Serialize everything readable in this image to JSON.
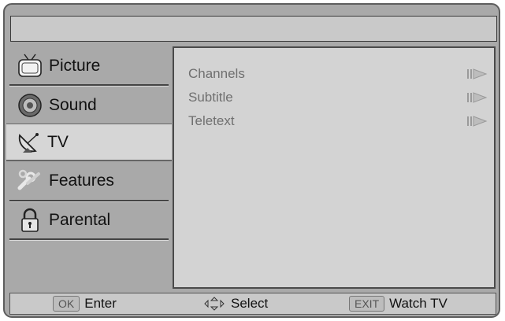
{
  "window": {
    "title": ""
  },
  "sidebar": {
    "items": [
      {
        "label": "Picture",
        "icon": "tv-icon"
      },
      {
        "label": "Sound",
        "icon": "speaker-icon"
      },
      {
        "label": "TV",
        "icon": "satellite-dish-icon"
      },
      {
        "label": "Features",
        "icon": "wrench-icon"
      },
      {
        "label": "Parental",
        "icon": "lock-icon"
      }
    ],
    "active_index": 2
  },
  "submenu": {
    "items": [
      {
        "label": "Channels"
      },
      {
        "label": "Subtitle"
      },
      {
        "label": "Teletext"
      }
    ]
  },
  "footer": {
    "enter_key": "OK",
    "enter_label": "Enter",
    "select_label": "Select",
    "exit_key": "EXIT",
    "exit_label": "Watch TV"
  },
  "colors": {
    "frame_bg": "#a9a9a9",
    "panel_bg": "#d3d3d3",
    "active_item_bg": "#d6d6d6",
    "submenu_text": "#6f6f6f"
  }
}
